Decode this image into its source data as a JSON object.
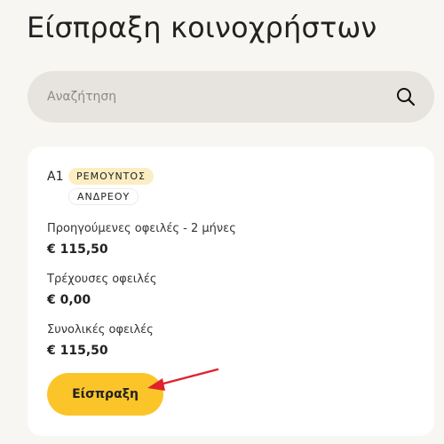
{
  "page": {
    "title": "Είσπραξη κοινοχρήστων"
  },
  "search": {
    "placeholder": "Αναζήτηση",
    "icon": "search-icon"
  },
  "unit": {
    "code": "Α1",
    "owner_surname": "ΡΕΜΟΥΝΤΟΣ",
    "owner_firstname": "ΑΝΔΡΕΟΥ",
    "previous_debts_label": "Προηγούμενες οφειλές - 2 μήνες",
    "previous_debts_value": "€ 115,50",
    "current_debts_label": "Τρέχουσες οφειλές",
    "current_debts_value": "€ 0,00",
    "total_debts_label": "Συνολικές οφειλές",
    "total_debts_value": "€ 115,50",
    "collect_label": "Είσπραξη"
  },
  "colors": {
    "background": "#f8f6f2",
    "search_bg": "#e7e4df",
    "card_bg": "#ffffff",
    "accent": "#fbc52a",
    "badge_bg": "#fbeec2",
    "annotation_arrow": "#e0202a"
  }
}
